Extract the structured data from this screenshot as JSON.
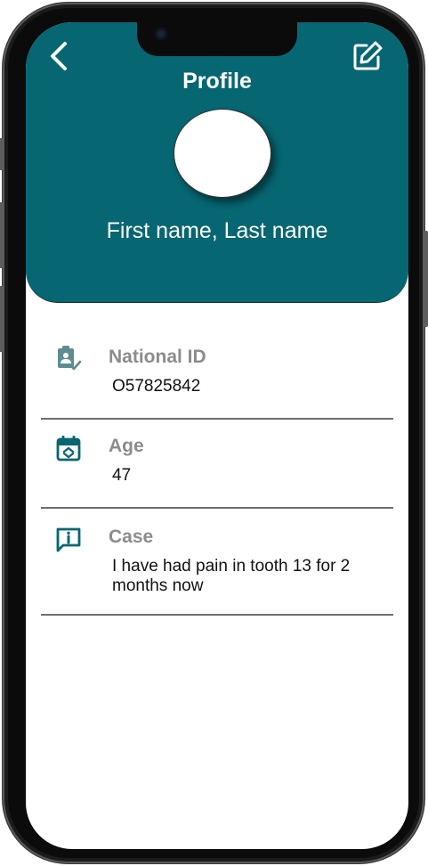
{
  "header": {
    "title": "Profile",
    "user_name": "First name, Last name",
    "back_icon": "chevron-left-icon",
    "edit_icon": "edit-square-icon"
  },
  "fields": [
    {
      "label": "National ID",
      "value": "O57825842",
      "icon": "id-badge-check-icon"
    },
    {
      "label": "Age",
      "value": "47",
      "icon": "calendar-icon"
    },
    {
      "label": "Case",
      "value": "I have had pain in tooth 13 for 2 months now",
      "icon": "message-info-icon"
    }
  ],
  "colors": {
    "primary": "#066672",
    "label": "#8c8c8c",
    "divider": "#6f6f6f"
  }
}
